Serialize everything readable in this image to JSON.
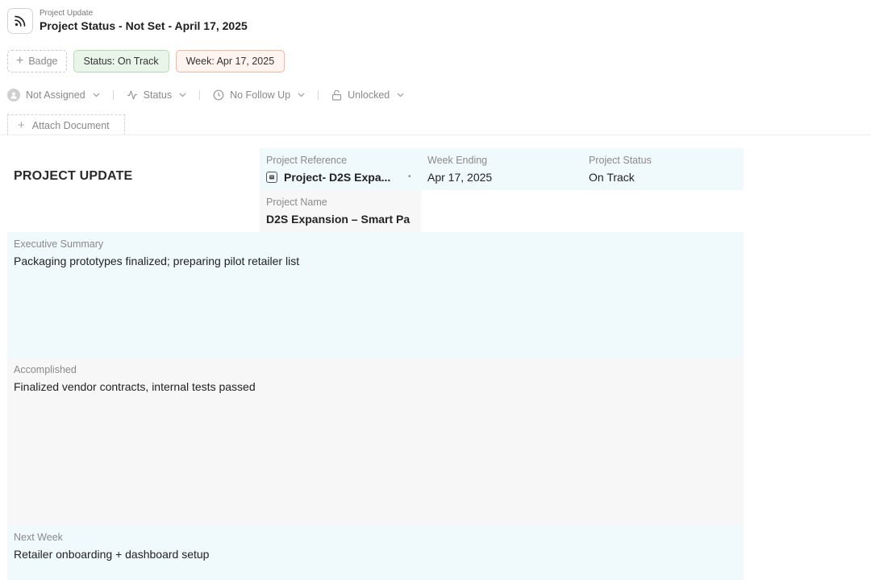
{
  "header": {
    "kicker": "Project Update",
    "title": "Project Status - Not Set - April 17, 2025",
    "icon": "rss-icon"
  },
  "badges": {
    "add_label": "Badge",
    "status": "Status: On Track",
    "week": "Week: Apr 17, 2025"
  },
  "properties": {
    "assignee": "Not Assigned",
    "status": "Status",
    "follow_up": "No Follow Up",
    "lock": "Unlocked"
  },
  "attach": {
    "label": "Attach Document"
  },
  "card": {
    "title": "PROJECT UPDATE",
    "project_reference": {
      "label": "Project Reference",
      "value": "Project- D2S Expa..."
    },
    "week_ending": {
      "label": "Week Ending",
      "value": "Apr 17, 2025"
    },
    "project_status": {
      "label": "Project Status",
      "value": "On Track"
    },
    "project_name": {
      "label": "Project Name",
      "value": "D2S Expansion – Smart Pa"
    },
    "executive_summary": {
      "label": "Executive Summary",
      "value": "Packaging prototypes finalized; preparing pilot retailer list"
    },
    "accomplished": {
      "label": "Accomplished",
      "value": "Finalized vendor contracts, internal tests passed"
    },
    "next_week": {
      "label": "Next Week",
      "value": "Retailer onboarding + dashboard setup"
    }
  },
  "colors": {
    "blue_cell": "#f0f9fc",
    "grey_cell": "#f7f7f7",
    "status_badge_bg": "#eaf5ea",
    "week_badge_border": "#f2b7a5"
  }
}
